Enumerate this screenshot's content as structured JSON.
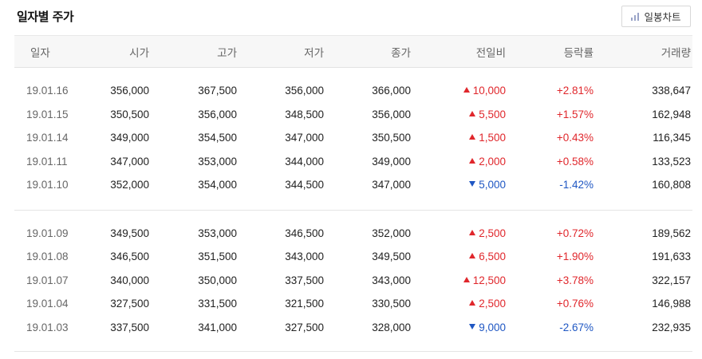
{
  "header": {
    "title": "일자별 주가",
    "chart_button_label": "일봉차트"
  },
  "table": {
    "columns": [
      "일자",
      "시가",
      "고가",
      "저가",
      "종가",
      "전일비",
      "등락률",
      "거래량"
    ],
    "groups": [
      [
        {
          "date": "19.01.16",
          "open": "356,000",
          "high": "367,500",
          "low": "356,000",
          "close": "366,000",
          "dir": "up",
          "change": "10,000",
          "rate": "+2.81%",
          "volume": "338,647"
        },
        {
          "date": "19.01.15",
          "open": "350,500",
          "high": "356,000",
          "low": "348,500",
          "close": "356,000",
          "dir": "up",
          "change": "5,500",
          "rate": "+1.57%",
          "volume": "162,948"
        },
        {
          "date": "19.01.14",
          "open": "349,000",
          "high": "354,500",
          "low": "347,000",
          "close": "350,500",
          "dir": "up",
          "change": "1,500",
          "rate": "+0.43%",
          "volume": "116,345"
        },
        {
          "date": "19.01.11",
          "open": "347,000",
          "high": "353,000",
          "low": "344,000",
          "close": "349,000",
          "dir": "up",
          "change": "2,000",
          "rate": "+0.58%",
          "volume": "133,523"
        },
        {
          "date": "19.01.10",
          "open": "352,000",
          "high": "354,000",
          "low": "344,500",
          "close": "347,000",
          "dir": "down",
          "change": "5,000",
          "rate": "-1.42%",
          "volume": "160,808"
        }
      ],
      [
        {
          "date": "19.01.09",
          "open": "349,500",
          "high": "353,000",
          "low": "346,500",
          "close": "352,000",
          "dir": "up",
          "change": "2,500",
          "rate": "+0.72%",
          "volume": "189,562"
        },
        {
          "date": "19.01.08",
          "open": "346,500",
          "high": "351,500",
          "low": "343,000",
          "close": "349,500",
          "dir": "up",
          "change": "6,500",
          "rate": "+1.90%",
          "volume": "191,633"
        },
        {
          "date": "19.01.07",
          "open": "340,000",
          "high": "350,000",
          "low": "337,500",
          "close": "343,000",
          "dir": "up",
          "change": "12,500",
          "rate": "+3.78%",
          "volume": "322,157"
        },
        {
          "date": "19.01.04",
          "open": "327,500",
          "high": "331,500",
          "low": "321,500",
          "close": "330,500",
          "dir": "up",
          "change": "2,500",
          "rate": "+0.76%",
          "volume": "146,988"
        },
        {
          "date": "19.01.03",
          "open": "337,500",
          "high": "341,000",
          "low": "327,500",
          "close": "328,000",
          "dir": "down",
          "change": "9,000",
          "rate": "-2.67%",
          "volume": "232,935"
        }
      ]
    ]
  },
  "colors": {
    "up": "#e0272c",
    "down": "#1f57c3"
  },
  "icons": {
    "chart_button": "bar-chart-icon",
    "up_marker": "triangle-up-icon",
    "down_marker": "triangle-down-icon"
  }
}
